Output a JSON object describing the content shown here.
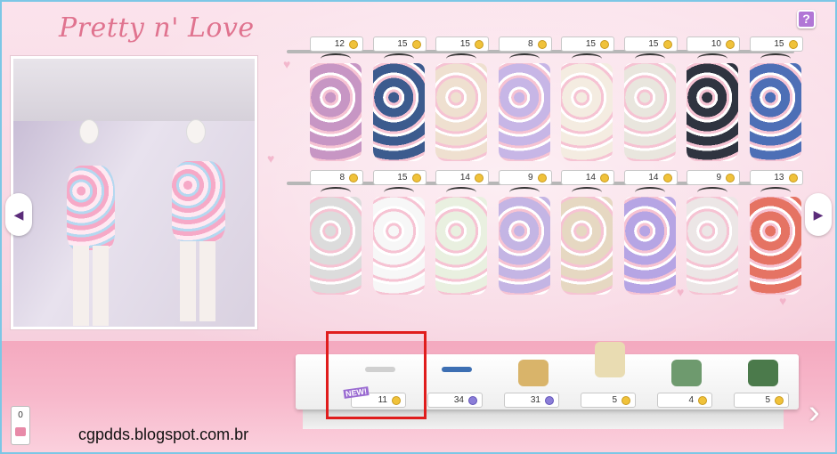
{
  "logo": "Pretty n' Love",
  "help_label": "?",
  "nav": {
    "prev": "◀",
    "next": "▶",
    "shelf_next": "›"
  },
  "rack_top": [
    {
      "price": "12",
      "currency": "coin",
      "color": "#c796c4",
      "name": "lace-blouse"
    },
    {
      "price": "15",
      "currency": "coin",
      "color": "#3c5b8e",
      "name": "floral-navy-dress"
    },
    {
      "price": "15",
      "currency": "coin",
      "color": "#efe0d0",
      "name": "floral-cream-dress"
    },
    {
      "price": "8",
      "currency": "coin",
      "color": "#c7b6e6",
      "name": "pastel-crop-top"
    },
    {
      "price": "15",
      "currency": "coin",
      "color": "#f4ece1",
      "name": "floral-maxi-dress"
    },
    {
      "price": "15",
      "currency": "coin",
      "color": "#e9e6de",
      "name": "floral-jacket"
    },
    {
      "price": "10",
      "currency": "coin",
      "color": "#2f3440",
      "name": "floral-off-shoulder-top"
    },
    {
      "price": "15",
      "currency": "coin",
      "color": "#4d6fb6",
      "name": "blue-lace-dress"
    }
  ],
  "rack_bottom": [
    {
      "price": "8",
      "currency": "coin",
      "color": "#dcdcdc",
      "name": "striped-leggings"
    },
    {
      "price": "15",
      "currency": "coin",
      "color": "#f7f7f7",
      "name": "ruffle-white-dress"
    },
    {
      "price": "14",
      "currency": "coin",
      "color": "#e9f0e0",
      "name": "floral-sundress"
    },
    {
      "price": "9",
      "currency": "coin",
      "color": "#c4b5e4",
      "name": "pastel-top"
    },
    {
      "price": "14",
      "currency": "coin",
      "color": "#e6d8c2",
      "name": "embroidered-dress"
    },
    {
      "price": "14",
      "currency": "coin",
      "color": "#b6a5e4",
      "name": "lilac-floral-dress"
    },
    {
      "price": "9",
      "currency": "coin",
      "color": "#ece6e6",
      "name": "floral-bandeau-top"
    },
    {
      "price": "13",
      "currency": "coin",
      "color": "#e57363",
      "name": "coral-peplum-skirt"
    }
  ],
  "shelf": [
    {
      "price": "11",
      "currency": "coin",
      "name": "necklace",
      "new": true,
      "color": "#d0d0d0"
    },
    {
      "price": "34",
      "currency": "diamond",
      "name": "blue-bracelet",
      "color": "#3d6fb3"
    },
    {
      "price": "31",
      "currency": "diamond",
      "name": "love-necklace",
      "color": "#d9b46a"
    },
    {
      "price": "5",
      "currency": "coin",
      "name": "cream-handbag",
      "color": "#e9dcb2"
    },
    {
      "price": "4",
      "currency": "coin",
      "name": "floral-clutch",
      "color": "#6e9a6e"
    },
    {
      "price": "5",
      "currency": "coin",
      "name": "floral-heels",
      "color": "#4b7a4b"
    }
  ],
  "new_badge": "NEW!",
  "bag_count": "0",
  "watermark": "cgpdds.blogspot.com.br"
}
